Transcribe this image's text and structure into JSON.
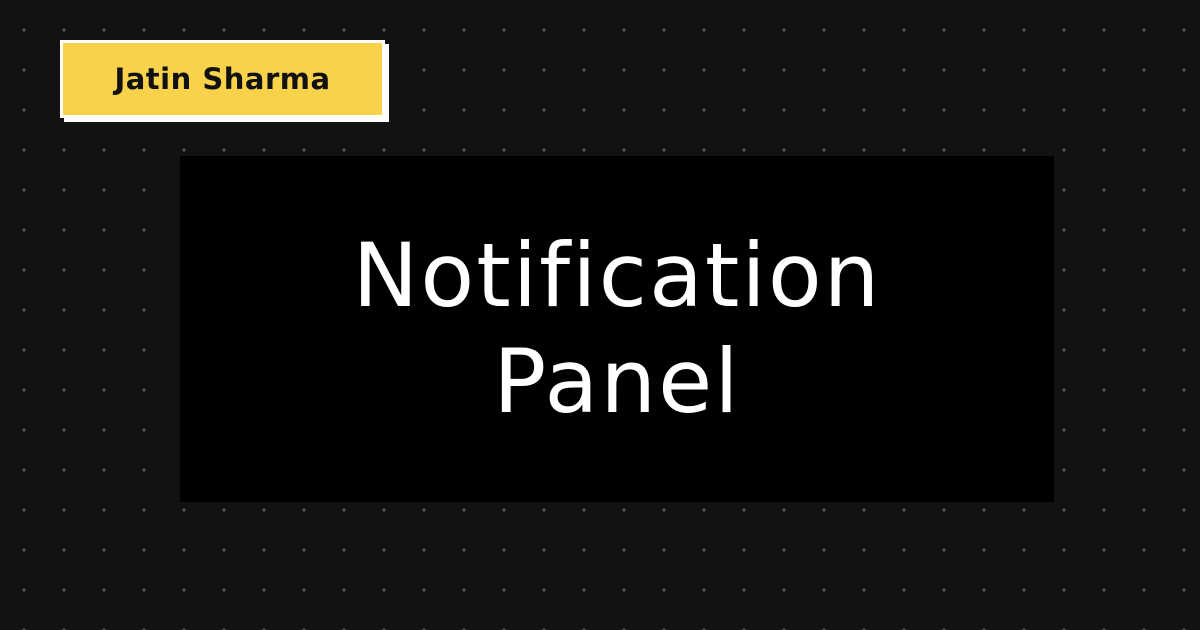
{
  "author": {
    "name": "Jatin Sharma"
  },
  "title": {
    "line1": "Notification",
    "line2": "Panel"
  },
  "colors": {
    "background": "#121212",
    "dot": "#5a5a5a",
    "badge": "#f7d24a",
    "panel": "#000000",
    "title_text": "#ffffff"
  }
}
